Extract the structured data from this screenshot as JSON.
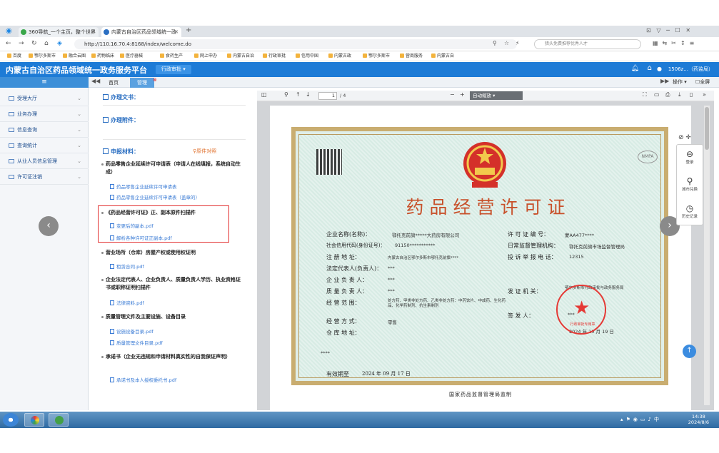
{
  "browser": {
    "tabs": [
      {
        "label": "360导航_一个主页，整个世界",
        "color": "#3aa74a"
      },
      {
        "label": "内蒙古自治区药品领域统一政",
        "color": "#2b6fc2"
      }
    ],
    "url": "http://110.16.70.4:8168/index/welcome.do",
    "search_placeholder": "猎头免费推荐优秀人才",
    "bookmarks": [
      "百度",
      "鄂尔多斯市",
      "融合云图",
      "药物临床",
      "医疗器械",
      "食药生产",
      "网上申办",
      "内蒙古自治",
      "行政审批",
      "信用中国",
      "内蒙古政",
      "鄂尔多斯市",
      "营商服务",
      "内蒙古自"
    ]
  },
  "app": {
    "title": "内蒙古自治区药品领域统一政务服务平台",
    "dept_label": "行政审批",
    "user_label": "1506z...（药监局）",
    "menu_toggle": "≡",
    "tabs": [
      {
        "label": "首页",
        "active": false
      },
      {
        "label": "管理",
        "active": true
      }
    ],
    "right_links": [
      "操作",
      "全屏"
    ]
  },
  "sidebar": {
    "items": [
      {
        "label": "受理大厅"
      },
      {
        "label": "业务办理"
      },
      {
        "label": "信息查询"
      },
      {
        "label": "查询统计"
      },
      {
        "label": "从业人员信息管理"
      },
      {
        "label": "许可证注销"
      }
    ]
  },
  "leftpanel": {
    "section_docs": "办理文书：",
    "section_attach": "办理附件：",
    "section_materials": "申报材料：",
    "compare_link": "原件对照",
    "materials": [
      {
        "title": "药品零售企业延续许可申请表（申请人在线填报，系统自动生成）",
        "files": [
          "药品零售企业延续许可申请表",
          "药品零售企业延续许可申请表（盖章的）"
        ]
      },
      {
        "title": "《药品经营许可证》正、副本原件扫描件",
        "files": [
          "变更后的副本.pdf",
          "解析各种许可证正副本.pdf"
        ]
      },
      {
        "title": "营业场所（仓库）房屋产权或使用权证明",
        "files": [
          "租赁合同.pdf"
        ]
      },
      {
        "title": "企业法定代表人、企业负责人、质量负责人学历、执业资格证书或职称证明扫描件",
        "files": [
          "法律资料.pdf"
        ]
      },
      {
        "title": "质量管理文件及主要设施、设备目录",
        "files": [
          "设施设备目录.pdf",
          "质量管理文件目录.pdf"
        ]
      },
      {
        "title": "承诺书（企业无违规和申请材料真实性的自我保证声明）",
        "files": [
          "承诺书及本人授权委托书.pdf"
        ]
      }
    ]
  },
  "pdf": {
    "page": "1",
    "total": "/ 4",
    "zoom": "自动缩放"
  },
  "certificate": {
    "title": "药品经营许可证",
    "labels": {
      "company": "企业名称(名称)：",
      "credit": "社会信用代码(身份证号)：",
      "address": "注  册  地  址：",
      "legal": "法定代表人(负责人)：",
      "head": "企  业  负  责  人：",
      "quality": "质  量  负  责  人：",
      "scope": "经  营  范  围：",
      "mode": "经  营  方  式：",
      "warehouse": "仓  库  地  址：",
      "license_no": "许 可 证 编 号：",
      "authority": "日常监督管理机构：",
      "hotline": "投 诉 举 报 电 话：",
      "issuer": "发  证  机  关：",
      "signer": "签        发  人：",
      "valid": "有效期至",
      "valid_date": "2024  年  09 月  17 日",
      "issue_year": "2024 年 10 月 19 日"
    },
    "values": {
      "company": "鄂托克前旗*****大药房有限公司",
      "credit": "91150***********",
      "address": "内蒙古自治区鄂尔多斯市鄂托克前旗****",
      "legal": "***",
      "head": "***",
      "quality": "***",
      "scope": "处方药、甲类非处方药、乙类非处方药：中药饮片、中成药、生化药品、化学药制剂、抗生素制剂",
      "mode": "零售",
      "warehouse": "****",
      "license_no": "蒙AA477****",
      "authority": "鄂托克前旗市场监督管理局",
      "hotline": "12315",
      "issuer": "鄂尔多斯市行政审批与政务服务局",
      "signer": "***"
    },
    "stamp_text": "行政审批专用章",
    "footer": "国家药品监督管理局监制",
    "watermark": "NMPA"
  },
  "right_tools": [
    {
      "label": "登录",
      "glyph": "⊖"
    },
    {
      "label": "城市兑换",
      "glyph": "⚲"
    },
    {
      "label": "历史记录",
      "glyph": "◷"
    }
  ],
  "taskbar": {
    "time": "14:38",
    "date": "2024/8/6"
  }
}
